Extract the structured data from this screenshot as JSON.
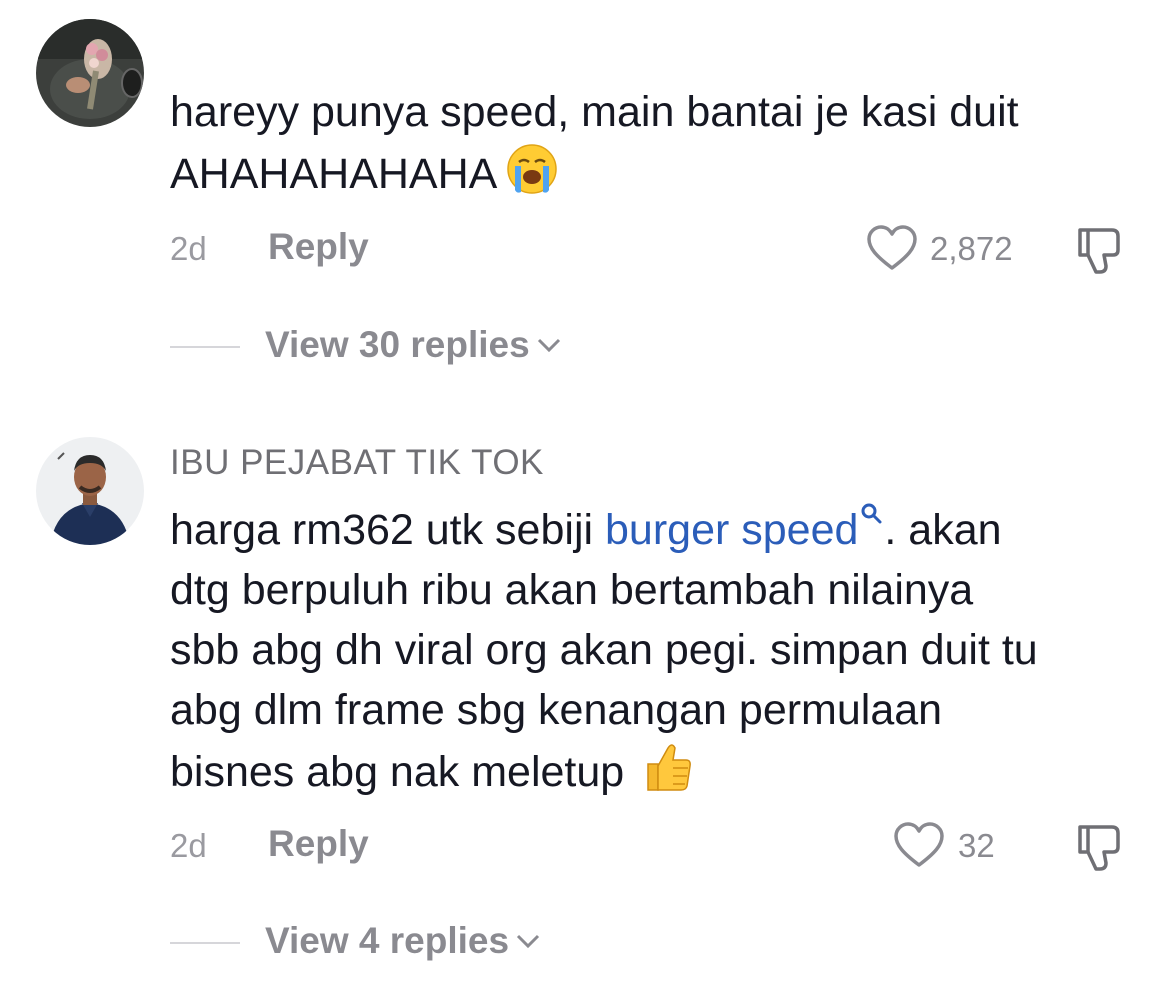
{
  "comments": [
    {
      "author": "",
      "text_lines": [
        "hareyy punya speed, main bantai je kasi duit",
        "AHAHAHAHAHA"
      ],
      "emoji": "loudly-crying-face-icon",
      "time": "2d",
      "reply_label": "Reply",
      "likes": "2,872",
      "view_replies": "View 30 replies"
    },
    {
      "author": "IBU PEJABAT TIK TOK",
      "text_lines": [
        {
          "before": "harga rm362 utk sebiji ",
          "link": "burger speed",
          "after": ". akan"
        },
        "dtg berpuluh ribu akan bertambah nilainya",
        "sbb abg dh viral org akan pegi. simpan duit tu",
        "abg dlm frame sbg kenangan permulaan",
        "bisnes abg nak meletup"
      ],
      "emoji": "thumbs-up-icon",
      "time": "2d",
      "reply_label": "Reply",
      "likes": "32",
      "view_replies": "View 4 replies"
    }
  ],
  "colors": {
    "text": "#161823",
    "muted": "#8a8a90",
    "link": "#2b5db9"
  }
}
